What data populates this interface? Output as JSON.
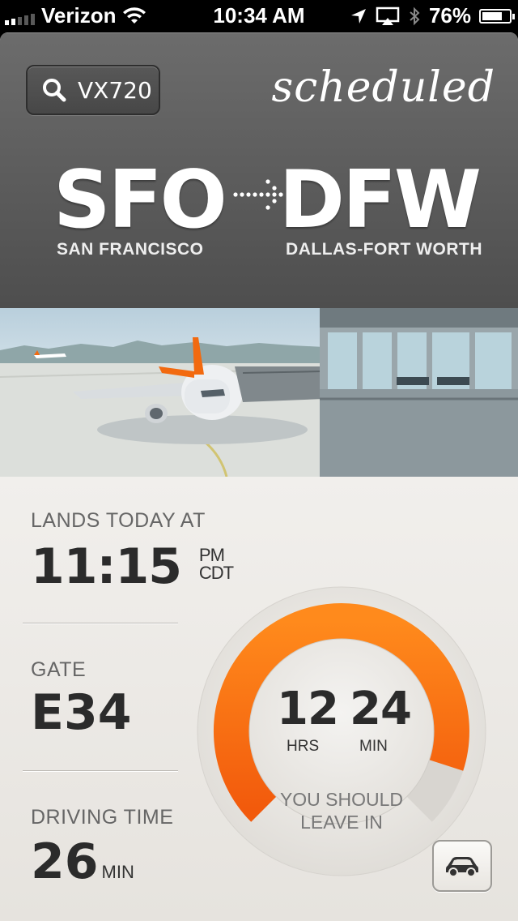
{
  "status_bar": {
    "carrier": "Verizon",
    "time": "10:34 AM",
    "battery": "76%",
    "battery_level": 0.76
  },
  "flight": {
    "number": "VX720",
    "status": "scheduled",
    "origin": {
      "code": "SFO",
      "city": "SAN FRANCISCO"
    },
    "destination": {
      "code": "DFW",
      "city": "DALLAS-FORT WORTH"
    }
  },
  "arrival": {
    "label": "LANDS TODAY AT",
    "time": "11:15",
    "ampm": "PM",
    "tz": "CDT"
  },
  "gate": {
    "label": "GATE",
    "value": "E34"
  },
  "driving": {
    "label": "DRIVING TIME",
    "value": "26",
    "unit": "MIN"
  },
  "countdown": {
    "hours": "12",
    "hours_unit": "HRS",
    "minutes": "24",
    "minutes_unit": "MIN",
    "caption_line1": "YOU SHOULD",
    "caption_line2": "LEAVE IN",
    "progress": 0.9
  },
  "colors": {
    "accent_orange": "#f26a10",
    "header_gray": "#5a5a5a",
    "panel": "#efedea"
  },
  "icons": {
    "search": "search-icon",
    "car": "car-icon",
    "route_arrow": "dotted-arrow-icon"
  }
}
